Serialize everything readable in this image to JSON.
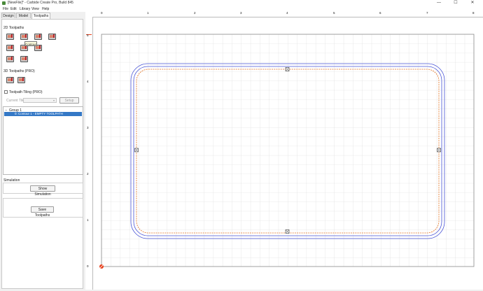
{
  "window": {
    "title": "[NewFile]* - Carbide Create Pro, Build 845",
    "minimize": "—",
    "maximize": "☐",
    "close": "✕"
  },
  "menu": [
    "File",
    "Edit",
    "Library",
    "View",
    "Help"
  ],
  "tabs": [
    {
      "label": "Design",
      "active": false
    },
    {
      "label": "Model",
      "active": false
    },
    {
      "label": "Toolpaths",
      "active": true
    }
  ],
  "toolpaths": {
    "section_2d": "2D Toolpaths",
    "tooltip": "Contour",
    "section_3d": "3D Toolpaths (PRO)",
    "tiling_label": "Toolpath Tiling (PRO)",
    "tiling_checked": false,
    "current_tile_label": "Current Tile",
    "current_tile_value": "",
    "setup_label": "Setup",
    "tree": {
      "group_label": "Group 1",
      "group_arrow": "⌄",
      "item_label": "0: Contour 1 - EMPTY TOOLPATH"
    }
  },
  "simulation": {
    "section_label": "Simulation",
    "show_button": "Show Simulation",
    "save_button": "Save Toolpaths"
  },
  "ruler": {
    "top_labels": [
      "0",
      "1",
      "2",
      "3",
      "4",
      "5",
      "6",
      "7",
      "8"
    ],
    "left_labels": [
      "5",
      "4",
      "3",
      "2",
      "1",
      "0"
    ]
  },
  "colors": {
    "outer_offset": "#4a55d6",
    "path_dashed": "#e2701f",
    "grid": "#d4d4d4",
    "selection": "#3478c6",
    "origin": "#e8401c"
  }
}
